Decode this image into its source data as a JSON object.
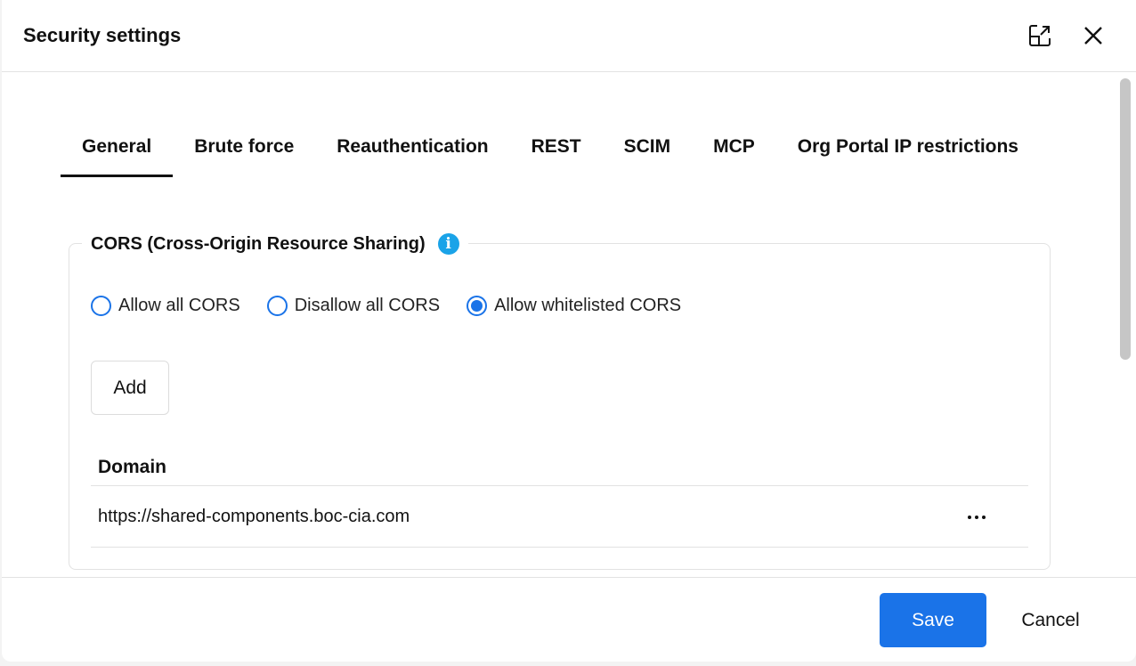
{
  "dialog": {
    "title": "Security settings"
  },
  "header_icons": {
    "popout": "popout-icon",
    "close": "close-icon"
  },
  "tabs": [
    {
      "label": "General",
      "active": true
    },
    {
      "label": "Brute force",
      "active": false
    },
    {
      "label": "Reauthentication",
      "active": false
    },
    {
      "label": "REST",
      "active": false
    },
    {
      "label": "SCIM",
      "active": false
    },
    {
      "label": "MCP",
      "active": false
    },
    {
      "label": "Org Portal IP restrictions",
      "active": false
    }
  ],
  "cors": {
    "legend": "CORS (Cross-Origin Resource Sharing)",
    "info_icon_glyph": "i",
    "options": [
      {
        "label": "Allow all CORS",
        "selected": false
      },
      {
        "label": "Disallow all CORS",
        "selected": false
      },
      {
        "label": "Allow whitelisted CORS",
        "selected": true
      }
    ],
    "add_label": "Add",
    "table": {
      "column_header": "Domain",
      "rows": [
        {
          "domain": "https://shared-components.boc-cia.com"
        }
      ]
    }
  },
  "footer": {
    "save_label": "Save",
    "cancel_label": "Cancel"
  },
  "colors": {
    "accent": "#1a73e8",
    "info": "#1aa3e8"
  }
}
